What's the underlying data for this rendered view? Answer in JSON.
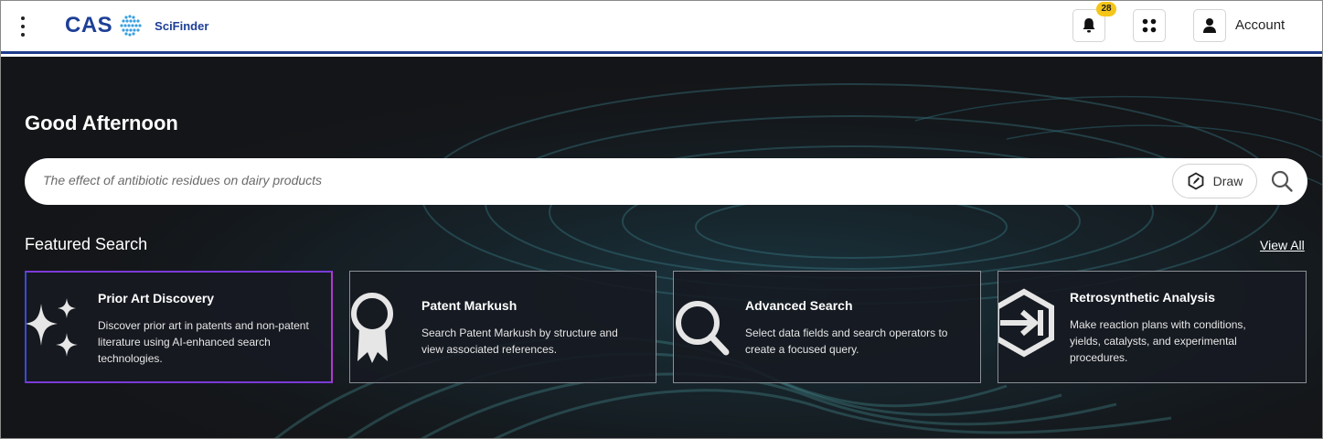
{
  "header": {
    "logo_text": "CAS",
    "product_name": "SciFinder",
    "notification_count": "28",
    "account_label": "Account",
    "brand_color": "#1d3f96"
  },
  "hero": {
    "greeting": "Good Afternoon",
    "search": {
      "placeholder": "The effect of antibiotic residues on dairy products",
      "draw_label": "Draw"
    },
    "featured": {
      "title": "Featured Search",
      "view_all": "View All",
      "cards": [
        {
          "title": "Prior Art Discovery",
          "description": "Discover prior art in patents and non-patent literature using AI-enhanced search technologies.",
          "icon": "sparkles-icon",
          "selected": true
        },
        {
          "title": "Patent Markush",
          "description": "Search Patent Markush by structure and view associated references.",
          "icon": "award-ribbon-icon",
          "selected": false
        },
        {
          "title": "Advanced Search",
          "description": "Select data fields and search operators to create a focused query.",
          "icon": "magnifier-icon",
          "selected": false
        },
        {
          "title": "Retrosynthetic Analysis",
          "description": "Make reaction plans with conditions, yields, catalysts, and experimental procedures.",
          "icon": "hexagon-arrow-icon",
          "selected": false
        }
      ]
    }
  },
  "colors": {
    "hero_background": "#141518",
    "selected_card_border": "#b03ad0",
    "badge": "#f5c518"
  }
}
